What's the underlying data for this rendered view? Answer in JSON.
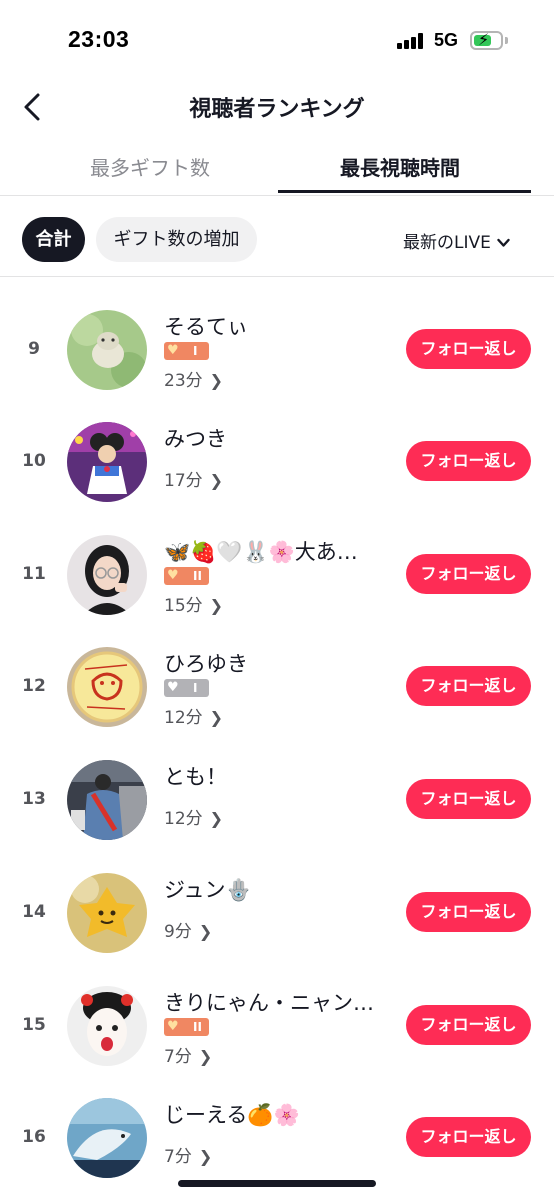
{
  "status_bar": {
    "time": "23:03",
    "network": "5G"
  },
  "header": {
    "title": "視聴者ランキング"
  },
  "tabs": [
    {
      "label": "最多ギフト数",
      "active": false
    },
    {
      "label": "最長視聴時間",
      "active": true
    }
  ],
  "filters": {
    "total": "合計",
    "gift_increase": "ギフト数の増加",
    "live_select": "最新のLIVE"
  },
  "follow_label": "フォロー返し",
  "rows": [
    {
      "rank": "9",
      "name": "そるてぃ",
      "badge": "orange",
      "badge_level": "I",
      "duration": "23分"
    },
    {
      "rank": "10",
      "name": "みつき",
      "badge": "",
      "badge_level": "",
      "duration": "17分"
    },
    {
      "rank": "11",
      "name": "🦋🍓🤍🐰🌸大あ…",
      "badge": "orange",
      "badge_level": "II",
      "duration": "15分"
    },
    {
      "rank": "12",
      "name": "ひろゆき",
      "badge": "gray",
      "badge_level": "I",
      "duration": "12分"
    },
    {
      "rank": "13",
      "name": "とも！",
      "badge": "",
      "badge_level": "",
      "duration": "12分"
    },
    {
      "rank": "14",
      "name": "ジュン🪬",
      "badge": "",
      "badge_level": "",
      "duration": "9分"
    },
    {
      "rank": "15",
      "name": "きりにゃん・ニャン…",
      "badge": "orange",
      "badge_level": "II",
      "duration": "7分"
    },
    {
      "rank": "16",
      "name": "じーえる🍊🌸",
      "badge": "",
      "badge_level": "",
      "duration": "7分"
    }
  ]
}
